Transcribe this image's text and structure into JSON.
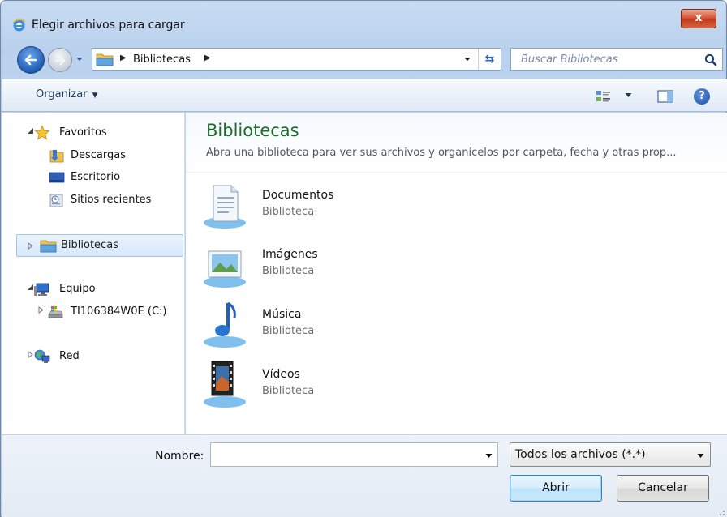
{
  "window": {
    "title": "Elegir archivos para cargar",
    "close_label": "x"
  },
  "address": {
    "crumbs": [
      "Bibliotecas"
    ],
    "search_placeholder": "Buscar Bibliotecas"
  },
  "toolbar": {
    "organize_label": "Organizar"
  },
  "nav": {
    "favorites": {
      "label": "Favoritos",
      "items": [
        {
          "label": "Descargas",
          "icon": "downloads-folder-icon"
        },
        {
          "label": "Escritorio",
          "icon": "desktop-icon"
        },
        {
          "label": "Sitios recientes",
          "icon": "recent-places-icon"
        }
      ]
    },
    "libraries": {
      "label": "Bibliotecas"
    },
    "computer": {
      "label": "Equipo",
      "items": [
        {
          "label": "TI106384W0E (C:)",
          "icon": "drive-icon"
        }
      ]
    },
    "network": {
      "label": "Red"
    }
  },
  "content": {
    "title": "Bibliotecas",
    "description": "Abra una biblioteca para ver sus archivos y organícelos por carpeta, fecha y otras prop...",
    "libraries": [
      {
        "name": "Documentos",
        "type": "Biblioteca",
        "icon": "documents-library-icon"
      },
      {
        "name": "Imágenes",
        "type": "Biblioteca",
        "icon": "pictures-library-icon"
      },
      {
        "name": "Música",
        "type": "Biblioteca",
        "icon": "music-library-icon"
      },
      {
        "name": "Vídeos",
        "type": "Biblioteca",
        "icon": "videos-library-icon"
      }
    ]
  },
  "footer": {
    "name_label": "Nombre:",
    "name_value": "",
    "filetype_selected": "Todos los archivos (*.*)",
    "open_label": "Abrir",
    "cancel_label": "Cancelar"
  }
}
